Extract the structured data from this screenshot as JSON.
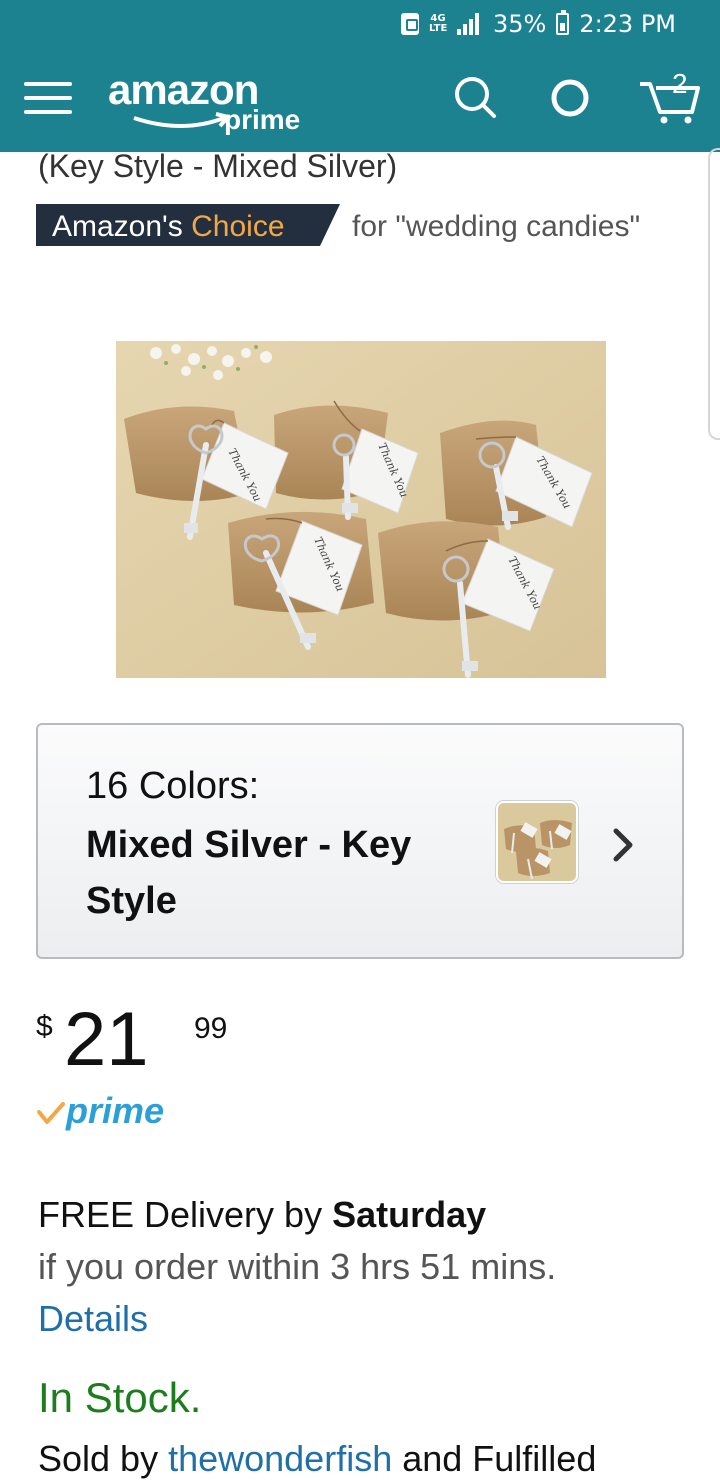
{
  "status_bar": {
    "lte": "4G LTE",
    "battery": "35%",
    "time": "2:23 PM"
  },
  "header": {
    "logo_text": "amazon",
    "logo_sub": "prime",
    "cart_count": "2",
    "background": "#1d8290"
  },
  "product": {
    "subtitle": "(Key Style - Mixed Silver)",
    "choice_prefix": "Amazon's ",
    "choice_highlight": "Choice",
    "choice_for": "for \"wedding candies\""
  },
  "variant": {
    "count_label": "16 Colors:",
    "selected": "Mixed Silver - Key Style"
  },
  "price": {
    "currency": "$",
    "whole": "21",
    "fraction": "99"
  },
  "prime": {
    "label": "prime"
  },
  "delivery": {
    "prefix": "FREE Delivery by ",
    "day": "Saturday",
    "window": "if you order within 3 hrs 51 mins.",
    "details_link": "Details"
  },
  "availability": {
    "status": "In Stock.",
    "sold_prefix": "Sold by ",
    "seller": "thewonderfish",
    "sold_suffix": " and Fulfilled"
  },
  "colors": {
    "teal": "#1d8290",
    "link": "#1f6fa8",
    "in_stock": "#1b7d1b",
    "choice_orange": "#f3a847"
  }
}
